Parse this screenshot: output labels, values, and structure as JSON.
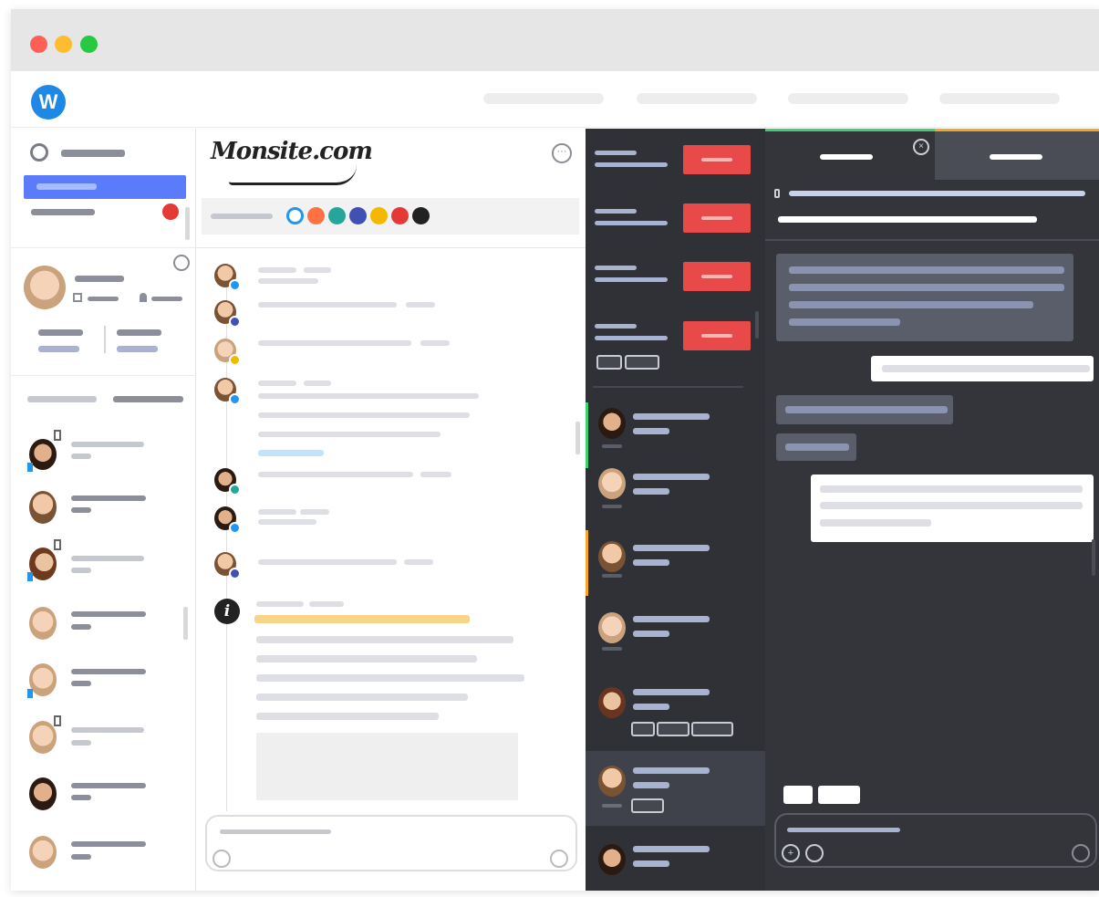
{
  "app": {
    "logo_glyph": "W",
    "brand_color": "#1e88e5",
    "window_controls": [
      "close",
      "minimize",
      "maximize"
    ]
  },
  "conversation": {
    "brand_logo_text": "Monsite.com",
    "channel_icons": [
      {
        "name": "chat-icon",
        "color": "#2196f3"
      },
      {
        "name": "sms-icon",
        "color": "#ff7043"
      },
      {
        "name": "phone-icon",
        "color": "#26a69a"
      },
      {
        "name": "check-icon",
        "color": "#3f51b5"
      },
      {
        "name": "email-icon",
        "color": "#f5b800"
      },
      {
        "name": "alert-icon",
        "color": "#e53935"
      },
      {
        "name": "info-icon",
        "color": "#222222"
      }
    ]
  },
  "accent_colors": {
    "active_nav": "#5b7cfa",
    "new_message_button": "#e84a4a",
    "tab_green": "#3ecf6e",
    "tab_yellow": "#f5a623",
    "highlight_yellow": "#f7d488",
    "highlight_blue": "#bfe3fb"
  }
}
